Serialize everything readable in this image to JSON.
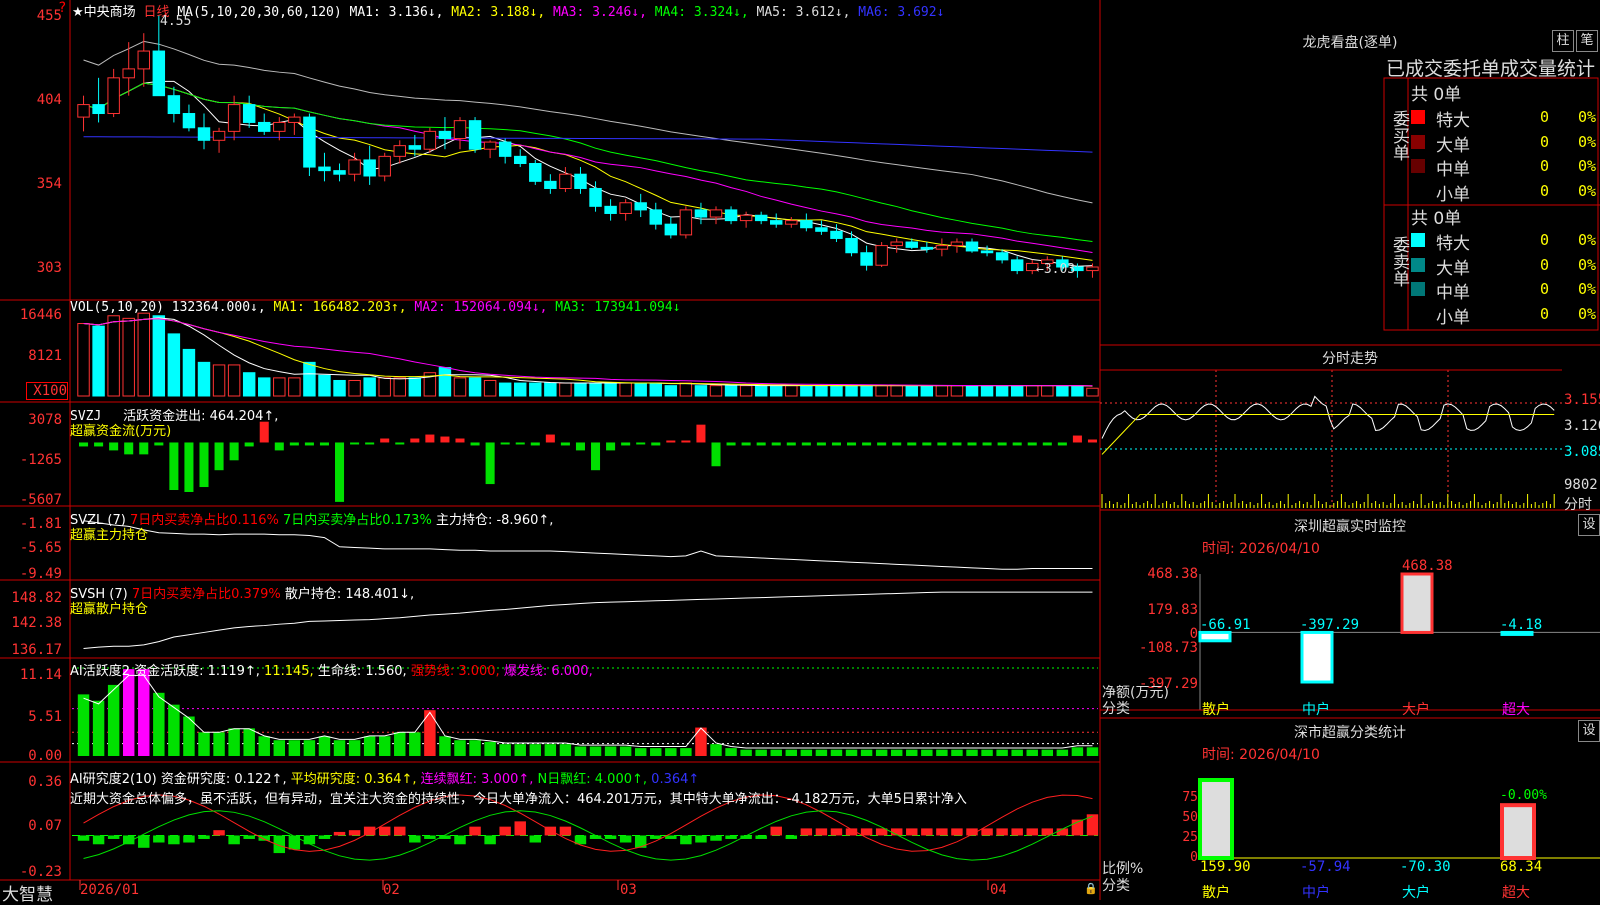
{
  "stock": {
    "name": "★中央商场",
    "period": "日线",
    "brand": "大智慧"
  },
  "ma_header": {
    "label": "MA(5,10,20,30,60,120)",
    "ma1": "MA1: 3.136↓,",
    "ma2": "MA2: 3.188↓,",
    "ma3": "MA3: 3.246↓,",
    "ma4": "MA4: 3.324↓,",
    "ma5": "MA5: 3.612↓,",
    "ma6": "MA6: 3.692↓"
  },
  "price_axis": [
    "455",
    "404",
    "354",
    "303"
  ],
  "price_marks": {
    "high": "4.55",
    "low": "←3.03"
  },
  "vol_header": {
    "label": "VOL(5,10,20)",
    "val": "132364.000↓,",
    "ma1": "MA1: 166482.203↑,",
    "ma2": "MA2: 152064.094↓,",
    "ma3": "MA3: 173941.094↓"
  },
  "vol_axis": [
    "16446",
    "8121",
    "X100"
  ],
  "svzj": {
    "label": "SVZJ",
    "text": "活跃资金进出: 464.204↑,",
    "sub": "超赢资金流(万元)",
    "axis": [
      "3078",
      "-1265",
      "-5607"
    ]
  },
  "svzl": {
    "label": "SVZL (7)",
    "t1": "7日内买卖净占比0.116%",
    "t2": "7日内买卖净占比0.173%",
    "t3": "主力持仓: -8.960↑,",
    "sub": "超赢主力持仓",
    "axis": [
      "-1.81",
      "-5.65",
      "-9.49"
    ]
  },
  "svsh": {
    "label": "SVSH (7)",
    "t1": "7日内买卖净占比0.379%",
    "t2": "散户持仓: 148.401↓,",
    "sub": "超赢散户持仓",
    "axis": [
      "148.82",
      "142.38",
      "136.17"
    ]
  },
  "ai1": {
    "label": "AI活跃度2",
    "t1": "资金活跃度: 1.119↑,",
    "t2": "11.145,",
    "t3": "生命线: 1.560,",
    "t4": "强势线: 3.000,",
    "t5": "爆发线: 6.000,",
    "axis": [
      "11.14",
      "5.51",
      "0.00"
    ]
  },
  "ai2": {
    "label": "AI研究度2(10)",
    "t1": "资金研究度: 0.122↑,",
    "t2": "平均研究度: 0.364↑,",
    "t3": "连续飘红: 3.000↑,",
    "t4": "N日飘红: 4.000↑,",
    "t5": "0.364↑",
    "note": "近期大资金总体偏多，虽不活跃，但有异动，宜关注大资金的持续性，今日大单净流入：464.201万元，其中特大单净流出：-4.182万元，大单5日累计净入",
    "axis": [
      "0.36",
      "0.07",
      "-0.23"
    ]
  },
  "dates": [
    "2026/01",
    "02",
    "03",
    "04"
  ],
  "right": {
    "lhb_title": "龙虎看盘(逐单)",
    "btn_zhu": "柱",
    "btn_bi": "笔",
    "stat_title": "已成交委托单成交量统计",
    "buy_label": "委买单",
    "sell_label": "委卖单",
    "buy_total": "共 0单",
    "sell_total": "共 0单",
    "rows": [
      "特大",
      "大单",
      "中单",
      "小单"
    ],
    "zero": "0",
    "pct": "0%",
    "fs_title": "分时走势",
    "fs_axis": [
      "3.155",
      "3.120",
      "3.085",
      "9802",
      "分时"
    ],
    "sz_title": "深圳超赢实时监控",
    "sz_time": "时间: 2026/04/10",
    "btn_set": "设",
    "sz_axis": [
      "468.38",
      "179.83",
      "0",
      "-108.73",
      "-397.29"
    ],
    "sz_vals": [
      "-66.91",
      "-397.29",
      "468.38",
      "-4.18"
    ],
    "sz_left": [
      "净额(万元)",
      "分类"
    ],
    "cats": [
      "散户",
      "中户",
      "大户",
      "超大"
    ],
    "ss_title": "深市超赢分类统计",
    "ss_time": "时间: 2026/04/10",
    "ss_axis": [
      "75",
      "50",
      "25",
      "0"
    ],
    "ss_vals": [
      "159.90",
      "-57.94",
      "-70.30",
      "68.34"
    ],
    "ss_top": "-0.00%",
    "ss_left": [
      "比例%",
      "分类"
    ]
  },
  "chart_data": [
    {
      "type": "candlestick",
      "name": "price",
      "ylim": [
        3.0,
        4.58
      ],
      "ohlc": [
        [
          3.98,
          4.1,
          3.9,
          4.05
        ],
        [
          4.05,
          4.2,
          3.95,
          4.0
        ],
        [
          4.0,
          4.25,
          3.98,
          4.2
        ],
        [
          4.2,
          4.4,
          4.1,
          4.25
        ],
        [
          4.25,
          4.45,
          4.15,
          4.35
        ],
        [
          4.35,
          4.55,
          4.2,
          4.1
        ],
        [
          4.1,
          4.15,
          3.95,
          4.0
        ],
        [
          4.0,
          4.05,
          3.9,
          3.92
        ],
        [
          3.92,
          4.0,
          3.8,
          3.85
        ],
        [
          3.85,
          3.92,
          3.78,
          3.9
        ],
        [
          3.9,
          4.1,
          3.85,
          4.05
        ],
        [
          4.05,
          4.1,
          3.92,
          3.95
        ],
        [
          3.95,
          4.0,
          3.88,
          3.9
        ],
        [
          3.9,
          3.98,
          3.85,
          3.95
        ],
        [
          3.95,
          4.0,
          3.88,
          3.98
        ],
        [
          3.98,
          4.0,
          3.65,
          3.7
        ],
        [
          3.7,
          3.78,
          3.62,
          3.68
        ],
        [
          3.68,
          3.72,
          3.62,
          3.66
        ],
        [
          3.66,
          3.78,
          3.62,
          3.74
        ],
        [
          3.74,
          3.82,
          3.6,
          3.65
        ],
        [
          3.65,
          3.78,
          3.62,
          3.76
        ],
        [
          3.76,
          3.85,
          3.72,
          3.82
        ],
        [
          3.82,
          3.88,
          3.76,
          3.8
        ],
        [
          3.8,
          3.92,
          3.78,
          3.9
        ],
        [
          3.9,
          3.98,
          3.8,
          3.86
        ],
        [
          3.86,
          3.98,
          3.8,
          3.96
        ],
        [
          3.96,
          3.98,
          3.78,
          3.8
        ],
        [
          3.8,
          3.85,
          3.75,
          3.84
        ],
        [
          3.84,
          3.86,
          3.72,
          3.76
        ],
        [
          3.76,
          3.8,
          3.7,
          3.72
        ],
        [
          3.72,
          3.74,
          3.6,
          3.62
        ],
        [
          3.62,
          3.66,
          3.55,
          3.58
        ],
        [
          3.58,
          3.7,
          3.56,
          3.66
        ],
        [
          3.66,
          3.7,
          3.55,
          3.58
        ],
        [
          3.58,
          3.62,
          3.45,
          3.48
        ],
        [
          3.48,
          3.52,
          3.4,
          3.44
        ],
        [
          3.44,
          3.52,
          3.4,
          3.5
        ],
        [
          3.5,
          3.55,
          3.42,
          3.46
        ],
        [
          3.46,
          3.5,
          3.35,
          3.38
        ],
        [
          3.38,
          3.42,
          3.3,
          3.32
        ],
        [
          3.32,
          3.48,
          3.3,
          3.46
        ],
        [
          3.46,
          3.5,
          3.38,
          3.42
        ],
        [
          3.42,
          3.48,
          3.38,
          3.46
        ],
        [
          3.46,
          3.48,
          3.38,
          3.4
        ],
        [
          3.4,
          3.45,
          3.36,
          3.43
        ],
        [
          3.43,
          3.45,
          3.38,
          3.4
        ],
        [
          3.4,
          3.44,
          3.36,
          3.38
        ],
        [
          3.38,
          3.42,
          3.36,
          3.4
        ],
        [
          3.4,
          3.44,
          3.34,
          3.36
        ],
        [
          3.36,
          3.4,
          3.32,
          3.34
        ],
        [
          3.34,
          3.38,
          3.28,
          3.3
        ],
        [
          3.3,
          3.34,
          3.2,
          3.22
        ],
        [
          3.22,
          3.26,
          3.12,
          3.15
        ],
        [
          3.15,
          3.28,
          3.14,
          3.26
        ],
        [
          3.26,
          3.3,
          3.22,
          3.28
        ],
        [
          3.28,
          3.3,
          3.24,
          3.25
        ],
        [
          3.25,
          3.28,
          3.22,
          3.24
        ],
        [
          3.24,
          3.3,
          3.2,
          3.26
        ],
        [
          3.26,
          3.3,
          3.22,
          3.28
        ],
        [
          3.28,
          3.3,
          3.22,
          3.23
        ],
        [
          3.23,
          3.26,
          3.2,
          3.22
        ],
        [
          3.22,
          3.24,
          3.16,
          3.18
        ],
        [
          3.18,
          3.2,
          3.1,
          3.12
        ],
        [
          3.12,
          3.18,
          3.1,
          3.16
        ],
        [
          3.16,
          3.2,
          3.12,
          3.18
        ],
        [
          3.18,
          3.2,
          3.12,
          3.14
        ],
        [
          3.14,
          3.16,
          3.08,
          3.12
        ],
        [
          3.12,
          3.16,
          3.08,
          3.14
        ]
      ]
    },
    {
      "type": "bar",
      "name": "volume",
      "ylim": [
        0,
        17000
      ],
      "values": [
        14000,
        13500,
        15500,
        15000,
        16000,
        15500,
        12000,
        9000,
        6500,
        6000,
        6000,
        4500,
        3500,
        3500,
        3500,
        6500,
        4000,
        3000,
        3000,
        3500,
        3500,
        3500,
        3500,
        4500,
        5500,
        3500,
        3500,
        3000,
        2500,
        2500,
        2500,
        2500,
        2500,
        2500,
        2500,
        2500,
        2500,
        2500,
        2500,
        2000,
        2500,
        2000,
        2000,
        2000,
        2000,
        2000,
        2000,
        2000,
        2000,
        2000,
        2000,
        2000,
        2000,
        2000,
        2000,
        2000,
        2000,
        2000,
        2000,
        2000,
        2000,
        2000,
        2000,
        2000,
        2000,
        2000,
        2000,
        1500
      ]
    },
    {
      "type": "bar",
      "name": "svzj",
      "ylim": [
        -5607,
        3078
      ],
      "values": [
        -400,
        -400,
        -800,
        -1200,
        -1200,
        -300,
        -4800,
        -5000,
        -4500,
        -2800,
        -1800,
        -400,
        2100,
        -800,
        -300,
        -300,
        -300,
        -6000,
        -200,
        -200,
        400,
        -200,
        400,
        800,
        600,
        400,
        -300,
        -4200,
        -200,
        -200,
        -300,
        800,
        -300,
        -800,
        -2800,
        -800,
        -300,
        -200,
        -300,
        200,
        200,
        1800,
        -2400,
        -300,
        -300,
        -300,
        -300,
        -300,
        -300,
        -300,
        -300,
        -300,
        -300,
        -300,
        -300,
        -300,
        -300,
        -300,
        -300,
        -300,
        -300,
        -300,
        -300,
        -300,
        -300,
        -300,
        700,
        300
      ]
    },
    {
      "type": "line",
      "name": "svzl",
      "ylim": [
        -9.49,
        -1.81
      ],
      "values": [
        -2.2,
        -2.5,
        -2.8,
        -3.0,
        -3.5,
        -3.9,
        -4.0,
        -4.1,
        -4.1,
        -4.2,
        -4.1,
        -4.1,
        -4.1,
        -4.2,
        -4.2,
        -4.3,
        -4.6,
        -5.9,
        -6.0,
        -6.1,
        -6.2,
        -6.2,
        -6.2,
        -6.2,
        -6.3,
        -6.4,
        -6.4,
        -6.5,
        -6.5,
        -6.5,
        -6.5,
        -6.5,
        -6.6,
        -6.7,
        -6.8,
        -6.9,
        -7.0,
        -7.1,
        -7.2,
        -7.3,
        -7.2,
        -6.5,
        -7.2,
        -7.3,
        -7.4,
        -7.5,
        -7.6,
        -7.7,
        -7.8,
        -7.9,
        -8.0,
        -8.1,
        -8.2,
        -8.3,
        -8.4,
        -8.5,
        -8.6,
        -8.7,
        -8.8,
        -8.9,
        -9.0,
        -9.1,
        -9.1,
        -9.0,
        -9.0,
        -9.0,
        -9.0,
        -9.0
      ]
    },
    {
      "type": "line",
      "name": "svsh",
      "ylim": [
        136.17,
        148.82
      ],
      "values": [
        136.5,
        136.8,
        137.0,
        137.0,
        137.3,
        138.0,
        139.0,
        139.5,
        140.0,
        140.5,
        141.0,
        141.3,
        141.5,
        141.8,
        142.0,
        142.4,
        142.5,
        142.6,
        142.7,
        142.8,
        143.0,
        143.2,
        143.5,
        143.8,
        144.0,
        144.2,
        144.5,
        144.8,
        145.0,
        145.3,
        145.6,
        145.9,
        146.1,
        146.3,
        146.5,
        146.6,
        146.7,
        146.8,
        146.9,
        147.0,
        147.1,
        147.2,
        147.3,
        147.4,
        147.5,
        147.6,
        147.7,
        147.8,
        147.9,
        148.0,
        148.1,
        148.2,
        148.3,
        148.4,
        148.5,
        148.6,
        148.7,
        148.8,
        148.8,
        148.8,
        148.8,
        148.8,
        148.8,
        148.8,
        148.8,
        148.8,
        148.8,
        148.8
      ]
    },
    {
      "type": "bar",
      "name": "ai_activity",
      "ylim": [
        0,
        11.14
      ],
      "values": [
        7.8,
        7.0,
        9.0,
        11.0,
        11.0,
        8.0,
        6.5,
        5.0,
        3.0,
        3.0,
        3.5,
        3.5,
        2.5,
        2.0,
        2.0,
        2.0,
        2.5,
        2.0,
        2.0,
        2.5,
        2.5,
        3.0,
        3.0,
        5.8,
        2.5,
        2.0,
        2.0,
        1.8,
        1.5,
        1.5,
        1.5,
        1.5,
        1.5,
        1.2,
        1.2,
        1.2,
        1.2,
        1.0,
        1.0,
        1.0,
        1.0,
        3.6,
        1.5,
        1.0,
        0.8,
        0.8,
        0.8,
        0.8,
        0.8,
        0.8,
        0.8,
        0.8,
        0.8,
        0.8,
        0.8,
        0.8,
        0.8,
        0.8,
        0.8,
        0.8,
        0.8,
        0.8,
        0.8,
        0.8,
        0.8,
        0.8,
        1.1,
        1.1
      ]
    },
    {
      "type": "bar",
      "name": "ai_research",
      "ylim": [
        -0.23,
        0.36
      ],
      "values": [
        -0.03,
        -0.05,
        -0.02,
        -0.05,
        -0.07,
        -0.04,
        -0.05,
        -0.04,
        -0.02,
        0.03,
        -0.05,
        -0.02,
        -0.03,
        -0.1,
        -0.08,
        -0.05,
        -0.02,
        0.02,
        0.03,
        0.05,
        0.05,
        0.05,
        -0.04,
        -0.02,
        -0.02,
        -0.05,
        0.05,
        -0.05,
        0.05,
        0.08,
        -0.04,
        0.05,
        0.05,
        -0.05,
        -0.02,
        -0.02,
        -0.04,
        -0.07,
        -0.02,
        -0.02,
        -0.05,
        -0.04,
        -0.03,
        -0.02,
        -0.02,
        -0.02,
        0.05,
        -0.02,
        0.04,
        0.04,
        0.04,
        0.04,
        0.04,
        0.04,
        0.04,
        0.04,
        0.04,
        0.04,
        0.04,
        0.04,
        0.04,
        0.04,
        0.04,
        0.04,
        0.04,
        0.04,
        0.09,
        0.12
      ]
    },
    {
      "type": "bar",
      "name": "sz_monitor",
      "categories": [
        "散户",
        "中户",
        "大户",
        "超大"
      ],
      "values": [
        -66.91,
        -397.29,
        468.38,
        -4.18
      ],
      "ylim": [
        -397.29,
        468.38
      ]
    },
    {
      "type": "bar",
      "name": "ss_stats",
      "categories": [
        "散户",
        "中户",
        "大户",
        "超大"
      ],
      "values": [
        100,
        0,
        0,
        68.34
      ],
      "ylim": [
        0,
        75
      ]
    }
  ]
}
